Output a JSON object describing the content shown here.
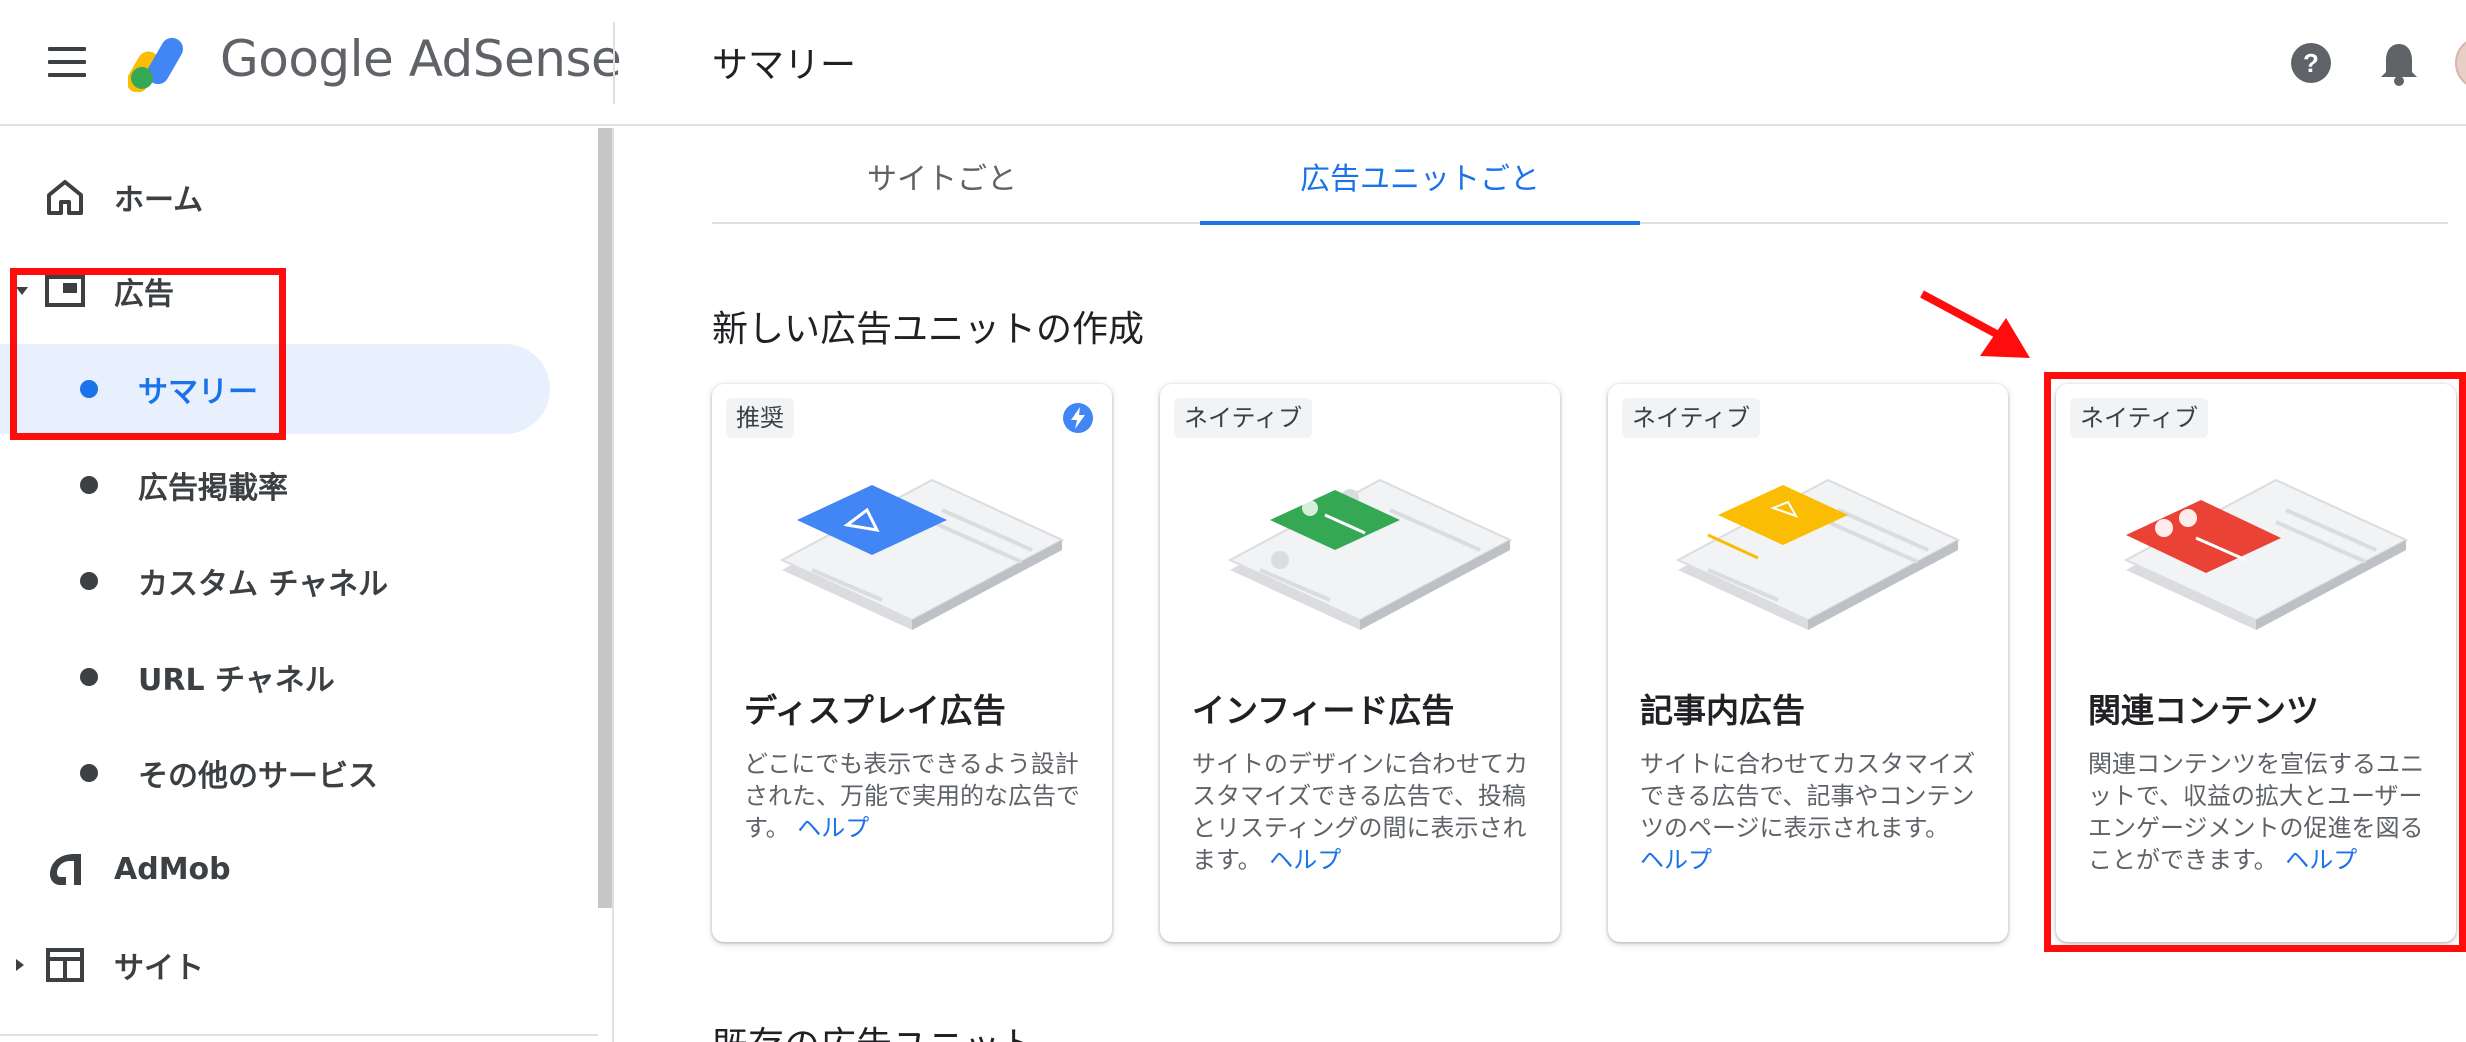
{
  "header": {
    "brand": "Google AdSense",
    "page_title": "サマリー"
  },
  "sidebar": {
    "items": [
      {
        "label": "ホーム",
        "icon": "home-icon"
      },
      {
        "label": "広告",
        "icon": "ads-icon"
      },
      {
        "label": "サマリー"
      },
      {
        "label": "広告掲載率"
      },
      {
        "label": "カスタム チャネル"
      },
      {
        "label": "URL チャネル"
      },
      {
        "label": "その他のサービス"
      },
      {
        "label": "AdMob",
        "icon": "admob-icon"
      },
      {
        "label": "サイト",
        "icon": "sites-icon"
      }
    ]
  },
  "tabs": [
    {
      "label": "サイトごと"
    },
    {
      "label": "広告ユニットごと"
    }
  ],
  "sections": {
    "new_ad_unit": "新しい広告ユニットの作成",
    "existing_ad_units": "既存の広告ユニット"
  },
  "cards": [
    {
      "badge": "推奨",
      "title": "ディスプレイ広告",
      "desc": "どこにでも表示できるよう設計された、万能で実用的な広告です。",
      "help": "ヘルプ",
      "accent": "#4285f4"
    },
    {
      "badge": "ネイティブ",
      "title": "インフィード広告",
      "desc": "サイトのデザインに合わせてカスタマイズできる広告で、投稿とリスティングの間に表示されます。",
      "help": "ヘルプ",
      "accent": "#34a853"
    },
    {
      "badge": "ネイティブ",
      "title": "記事内広告",
      "desc": "サイトに合わせてカスタマイズできる広告で、記事やコンテンツのページに表示されます。",
      "help": "ヘルプ",
      "accent": "#fbbc04"
    },
    {
      "badge": "ネイティブ",
      "title": "関連コンテンツ",
      "desc": "関連コンテンツを宣伝するユニットで、収益の拡大とユーザー エンゲージメントの促進を図ることができます。",
      "help": "ヘルプ",
      "accent": "#ea4335"
    }
  ],
  "colors": {
    "primary": "#1a73e8",
    "annotation": "#ff0d0d"
  }
}
